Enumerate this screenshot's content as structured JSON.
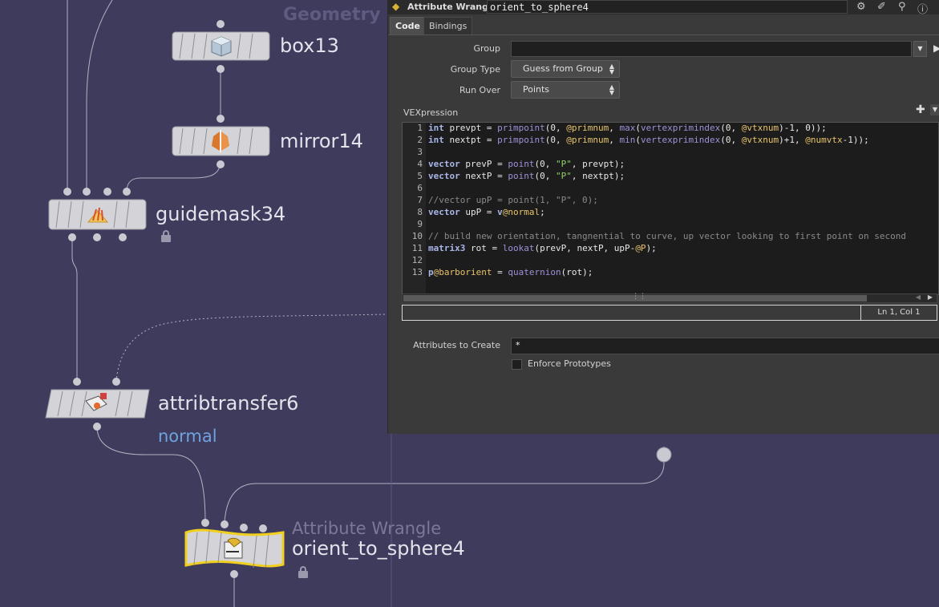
{
  "network": {
    "context_label": "Geometry",
    "nodes": {
      "box13": {
        "name": "box13"
      },
      "mirror14": {
        "name": "mirror14"
      },
      "guidemask34": {
        "name": "guidemask34"
      },
      "attribtransfer6": {
        "name": "attribtransfer6",
        "flag_text": "normal"
      },
      "orient_to_sphere4": {
        "type_label": "Attribute Wrangle",
        "name": "orient_to_sphere4"
      }
    }
  },
  "pane": {
    "node_type": "Attribute Wrangle",
    "node_name": "orient_to_sphere4",
    "tabs": [
      "Code",
      "Bindings"
    ],
    "group": {
      "label": "Group",
      "value": ""
    },
    "group_type": {
      "label": "Group Type",
      "value": "Guess from Group"
    },
    "run_over": {
      "label": "Run Over",
      "value": "Points"
    },
    "vex_label": "VEXpression",
    "code_lines": [
      "int prevpt = primpoint(0, @primnum, max(vertexprimindex(0, @vtxnum)-1, 0));",
      "int nextpt = primpoint(0, @primnum, min(vertexprimindex(0, @vtxnum)+1, @numvtx-1));",
      "",
      "vector prevP = point(0, \"P\", prevpt);",
      "vector nextP = point(0, \"P\", nextpt);",
      "",
      "//vector upP = point(1, \"P\", 0);",
      "vector upP = v@normal;",
      "",
      "// build new orientation, tangnential to curve, up vector looking to first point on second",
      "matrix3 rot = lookat(prevP, nextP, upP-@P);",
      "",
      "p@barborient = quaternion(rot);"
    ],
    "cursor_position": "Ln 1, Col 1",
    "attributes_to_create": {
      "label": "Attributes to Create",
      "value": "*"
    },
    "enforce_prototypes": {
      "label": "Enforce Prototypes",
      "checked": false
    }
  },
  "colors": {
    "network_bg": "#3f3b5c",
    "wire": "#b3b3c2",
    "selected_outline": "#f1cf1f",
    "pane_bg": "#3a3a3a"
  }
}
